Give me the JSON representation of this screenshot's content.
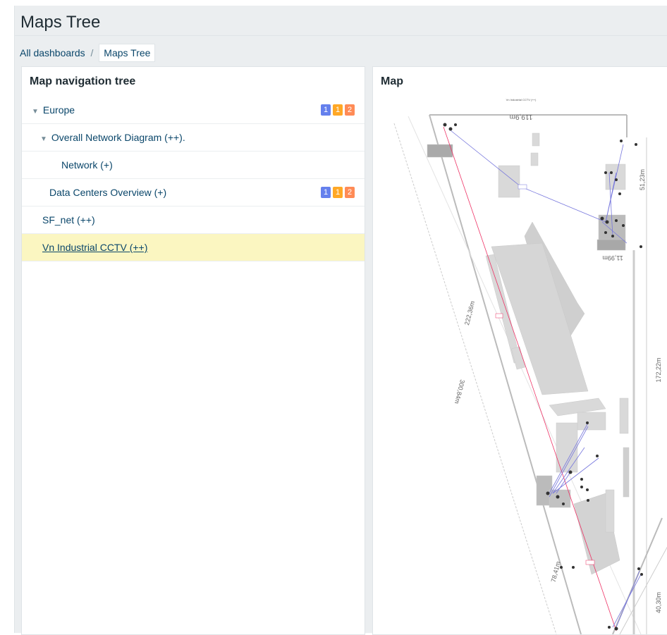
{
  "header": {
    "title": "Maps Tree"
  },
  "breadcrumb": {
    "parent": "All dashboards",
    "separator": "/",
    "current": "Maps Tree"
  },
  "tree_widget": {
    "title": "Map navigation tree",
    "items": [
      {
        "label": "Europe",
        "expanded": true,
        "badges": [
          "1",
          "1",
          "2"
        ]
      },
      {
        "label": "Overall Network Diagram (++).",
        "expanded": true
      },
      {
        "label": "Network (+)"
      },
      {
        "label": "Data Centers Overview (+)",
        "badges": [
          "1",
          "1",
          "2"
        ]
      },
      {
        "label": "SF_net (++)"
      },
      {
        "label": "Vn Industrial CCTV (++)",
        "selected": true
      }
    ],
    "badge_colors": [
      "#6580ed",
      "#ffa826",
      "#ff8b56"
    ]
  },
  "map_widget": {
    "title": "Map",
    "map_title": "Vn Industrial CCTV (++)",
    "measurements": [
      "119,9m",
      "51,23m",
      "11,99m",
      "222,36m",
      "300,84m",
      "172,22m",
      "78,41m",
      "40,30m"
    ]
  }
}
